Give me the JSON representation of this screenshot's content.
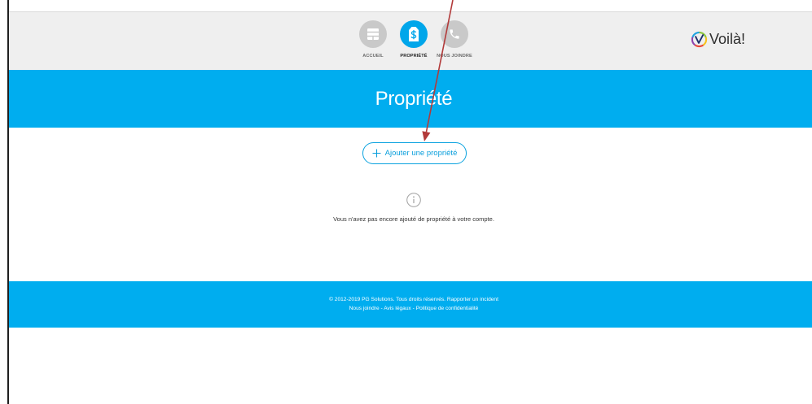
{
  "header": {
    "nav": [
      {
        "label": "ACCUEIL",
        "icon": "home-grid-icon",
        "active": false
      },
      {
        "label": "PROPRIÉTÉ",
        "icon": "price-tag-dollar-icon",
        "active": true
      },
      {
        "label": "NOUS JOINDRE",
        "icon": "phone-icon",
        "active": false
      }
    ],
    "logo": {
      "text": "Voilà!",
      "icon": "voila-check-circle-icon"
    }
  },
  "banner": {
    "title": "Propriété"
  },
  "main": {
    "add_button": {
      "icon": "plus-icon",
      "label": "Ajouter une propriété"
    },
    "empty_state": {
      "icon": "info-circle-icon",
      "message": "Vous n'avez pas encore ajouté de propriété à votre compte."
    }
  },
  "footer": {
    "copyright": "© 2012-2019 PG Solutions. Tous droits réservés.",
    "report_link": "Rapporter un incident",
    "links": [
      "Nous joindre",
      "Avis légaux",
      "Politique de confidentialité"
    ],
    "separator": "-"
  },
  "colors": {
    "brand_blue": "#00adef",
    "nav_active": "#00a6ea",
    "nav_inactive": "#c9c9c9",
    "header_bg": "#efefef",
    "annotation_arrow": "#b23a3a"
  }
}
